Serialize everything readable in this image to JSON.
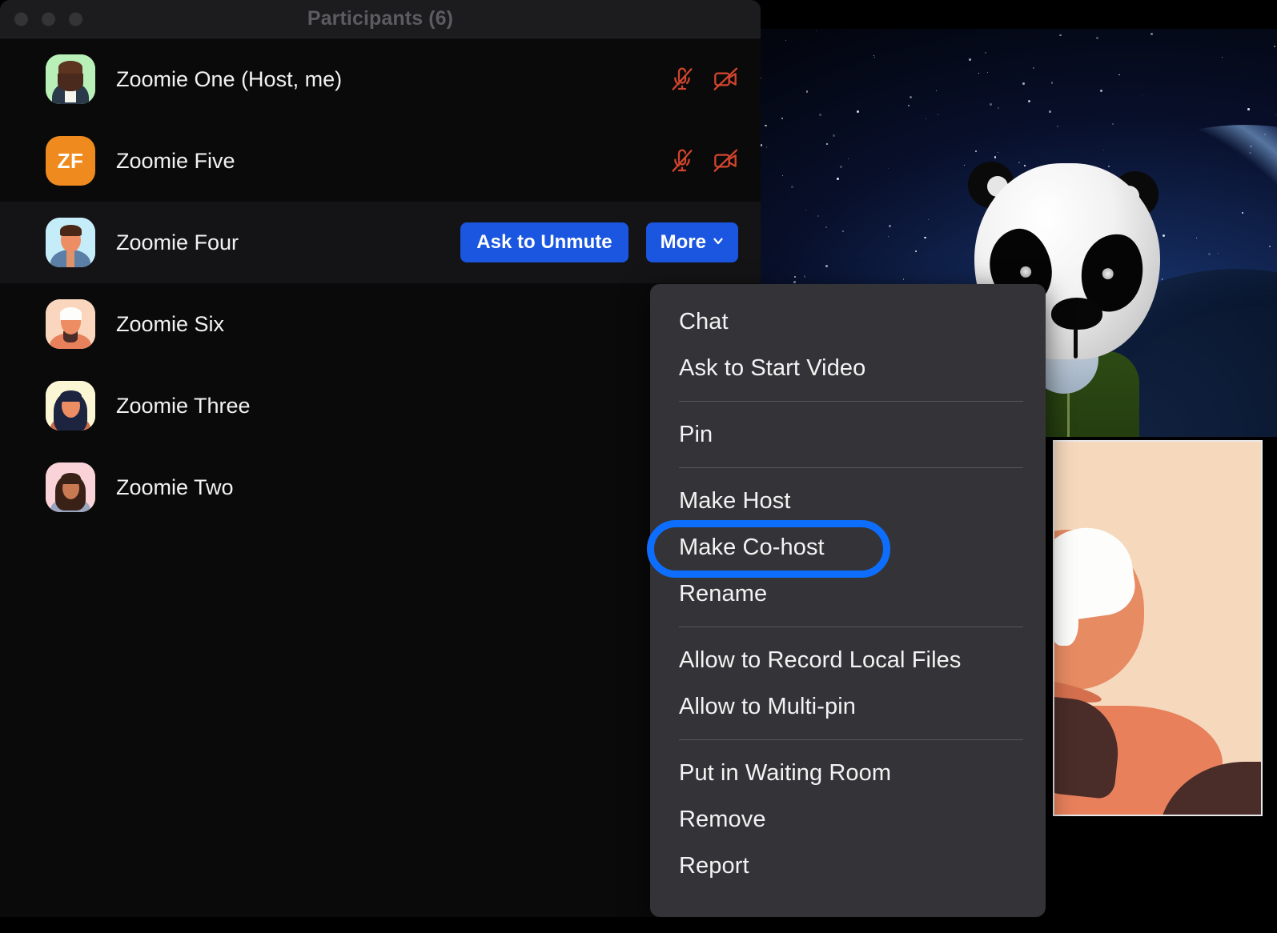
{
  "window": {
    "title": "Participants (6)",
    "traffic_lights": [
      "close",
      "minimize",
      "zoom"
    ]
  },
  "participants": {
    "count": 6,
    "rows": [
      {
        "name": "Zoomie One (Host, me)",
        "avatar_type": "photo",
        "avatar_bg": "#b8f0b8",
        "initials": "",
        "selected": false,
        "mic": "muted",
        "camera": "off",
        "has_actions": false
      },
      {
        "name": "Zoomie Five",
        "avatar_type": "initials",
        "avatar_bg": "#ef8a1f",
        "initials": "ZF",
        "selected": false,
        "mic": "muted",
        "camera": "off",
        "has_actions": false
      },
      {
        "name": "Zoomie Four",
        "avatar_type": "photo",
        "avatar_bg": "#c5edf9",
        "initials": "",
        "selected": true,
        "mic": "",
        "camera": "",
        "has_actions": true
      },
      {
        "name": "Zoomie Six",
        "avatar_type": "photo",
        "avatar_bg": "#f9d6bd",
        "initials": "",
        "selected": false,
        "mic": "",
        "camera": "",
        "has_actions": false
      },
      {
        "name": "Zoomie Three",
        "avatar_type": "photo",
        "avatar_bg": "#fbf6d4",
        "initials": "",
        "selected": false,
        "mic": "",
        "camera": "",
        "has_actions": false
      },
      {
        "name": "Zoomie Two",
        "avatar_type": "photo",
        "avatar_bg": "#fad3d8",
        "initials": "",
        "selected": false,
        "mic": "",
        "camera": "",
        "has_actions": false
      }
    ]
  },
  "row_actions": {
    "ask_to_unmute": "Ask to Unmute",
    "more": "More",
    "more_chevron": "chevron-down-icon"
  },
  "context_menu": {
    "items": [
      {
        "label": "Chat",
        "separator_after": false,
        "highlighted": false
      },
      {
        "label": "Ask to Start Video",
        "separator_after": true,
        "highlighted": false
      },
      {
        "label": "Pin",
        "separator_after": true,
        "highlighted": false
      },
      {
        "label": "Make Host",
        "separator_after": false,
        "highlighted": false
      },
      {
        "label": "Make Co-host",
        "separator_after": false,
        "highlighted": true
      },
      {
        "label": "Rename",
        "separator_after": true,
        "highlighted": false
      },
      {
        "label": "Allow to Record Local Files",
        "separator_after": false,
        "highlighted": false
      },
      {
        "label": "Allow to Multi-pin",
        "separator_after": true,
        "highlighted": false
      },
      {
        "label": "Put in Waiting Room",
        "separator_after": false,
        "highlighted": false
      },
      {
        "label": "Remove",
        "separator_after": false,
        "highlighted": false
      },
      {
        "label": "Report",
        "separator_after": false,
        "highlighted": false
      }
    ]
  },
  "annotation": {
    "target_label": "Make Co-host",
    "color": "#0d6efd",
    "shape": "rounded-rectangle-outline"
  },
  "colors": {
    "accent_blue": "#1a56e0",
    "annotation_blue": "#0d6efd",
    "muted_red": "#d4452e",
    "panel_bg": "#0a0a0a",
    "titlebar_bg": "#1c1c1e",
    "menu_bg": "#343438",
    "selected_row_bg": "#141416",
    "title_text": "#5c5c60"
  },
  "video": {
    "speaker_tile": {
      "background": "space-starfield-earth",
      "avatar": "panda-character"
    },
    "thumbnail_tile": {
      "background": "#f6d9bd",
      "avatar": "bald-person-illustration"
    }
  }
}
